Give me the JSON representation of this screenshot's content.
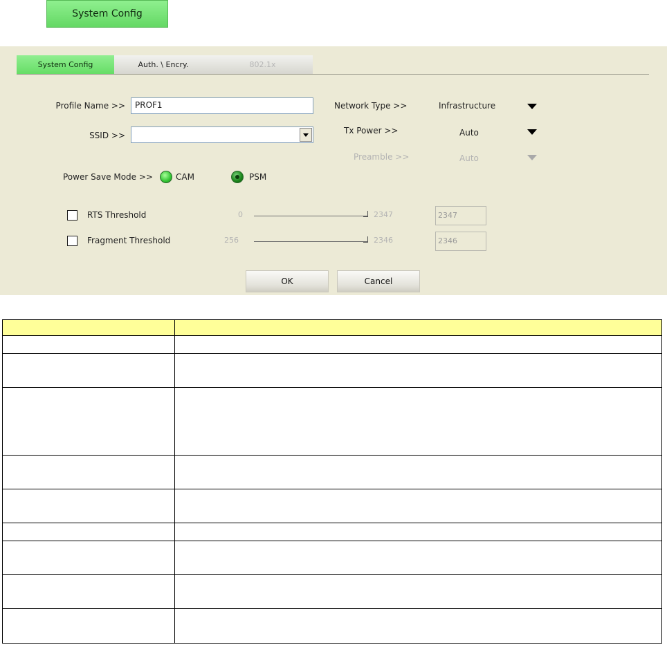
{
  "top_tab_label": "System Config",
  "tabs": [
    {
      "label": "System Config"
    },
    {
      "label": "Auth. \\ Encry."
    },
    {
      "label": "802.1x"
    }
  ],
  "profile_name": {
    "label": "Profile Name >>",
    "value": "PROF1"
  },
  "ssid": {
    "label": "SSID >>",
    "value": ""
  },
  "network_type": {
    "label": "Network Type >>",
    "value": "Infrastructure"
  },
  "tx_power": {
    "label": "Tx Power >>",
    "value": "Auto"
  },
  "preamble": {
    "label": "Preamble >>",
    "value": "Auto"
  },
  "power_save": {
    "label": "Power Save Mode >>",
    "options": [
      "CAM",
      "PSM"
    ],
    "selected": "PSM"
  },
  "rts": {
    "label": "RTS Threshold",
    "checked": false,
    "min": "0",
    "max": "2347",
    "value": "2347"
  },
  "fragment": {
    "label": "Fragment Threshold",
    "checked": false,
    "min": "256",
    "max": "2346",
    "value": "2346"
  },
  "buttons": {
    "ok": "OK",
    "cancel": "Cancel"
  },
  "table": {
    "header": [
      "",
      ""
    ],
    "rows": [
      {
        "c1": "",
        "c2": ""
      },
      {
        "c1": "",
        "c2": ""
      },
      {
        "c1": "",
        "c2": ""
      },
      {
        "c1": "",
        "c2": ""
      },
      {
        "c1": "",
        "c2": ""
      },
      {
        "c1": "",
        "c2": ""
      },
      {
        "c1": "",
        "c2": ""
      },
      {
        "c1": "",
        "c2": ""
      },
      {
        "c1": "",
        "c2": ""
      }
    ]
  },
  "colors": {
    "accent_green": "#66dd66",
    "panel_bg": "#ecead6",
    "table_header": "#ffff99"
  }
}
